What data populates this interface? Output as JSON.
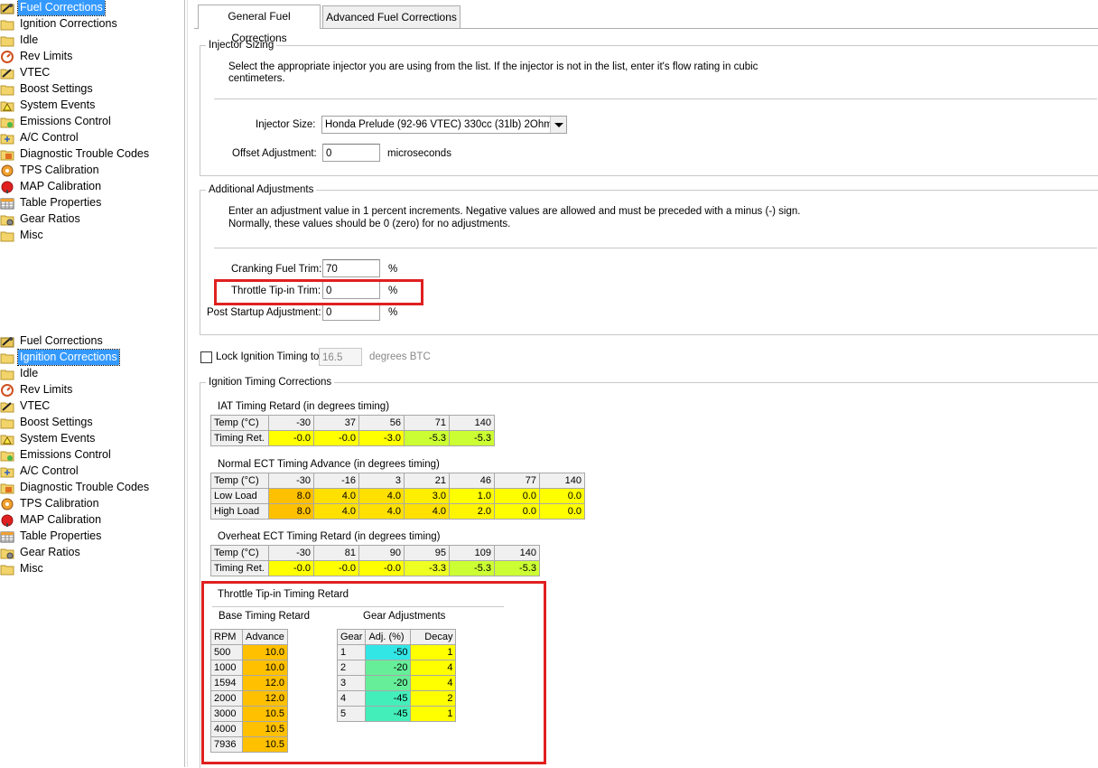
{
  "tree_top": {
    "selected_index": 0,
    "items": [
      {
        "label": "Fuel Corrections",
        "icon": "fuel-icon"
      },
      {
        "label": "Ignition Corrections",
        "icon": "folder-icon"
      },
      {
        "label": "Idle",
        "icon": "folder-icon"
      },
      {
        "label": "Rev Limits",
        "icon": "rev-limit-icon"
      },
      {
        "label": "VTEC",
        "icon": "vtec-icon"
      },
      {
        "label": "Boost Settings",
        "icon": "folder-icon"
      },
      {
        "label": "System Events",
        "icon": "warning-folder-icon"
      },
      {
        "label": "Emissions Control",
        "icon": "emissions-icon"
      },
      {
        "label": "A/C Control",
        "icon": "ac-icon"
      },
      {
        "label": "Diagnostic Trouble Codes",
        "icon": "dtc-icon"
      },
      {
        "label": "TPS Calibration",
        "icon": "tps-icon"
      },
      {
        "label": "MAP Calibration",
        "icon": "map-icon"
      },
      {
        "label": "Table Properties",
        "icon": "table-icon"
      },
      {
        "label": "Gear Ratios",
        "icon": "gear-icon"
      },
      {
        "label": "Misc",
        "icon": "folder-icon"
      }
    ]
  },
  "tree_bottom": {
    "selected_index": 1,
    "items": [
      {
        "label": "Fuel Corrections",
        "icon": "fuel-icon"
      },
      {
        "label": "Ignition Corrections",
        "icon": "folder-icon"
      },
      {
        "label": "Idle",
        "icon": "folder-icon"
      },
      {
        "label": "Rev Limits",
        "icon": "rev-limit-icon"
      },
      {
        "label": "VTEC",
        "icon": "vtec-icon"
      },
      {
        "label": "Boost Settings",
        "icon": "folder-icon"
      },
      {
        "label": "System Events",
        "icon": "warning-folder-icon"
      },
      {
        "label": "Emissions Control",
        "icon": "emissions-icon"
      },
      {
        "label": "A/C Control",
        "icon": "ac-icon"
      },
      {
        "label": "Diagnostic Trouble Codes",
        "icon": "dtc-icon"
      },
      {
        "label": "TPS Calibration",
        "icon": "tps-icon"
      },
      {
        "label": "MAP Calibration",
        "icon": "map-icon"
      },
      {
        "label": "Table Properties",
        "icon": "table-icon"
      },
      {
        "label": "Gear Ratios",
        "icon": "gear-icon"
      },
      {
        "label": "Misc",
        "icon": "folder-icon"
      }
    ]
  },
  "tabs": {
    "general": "General Fuel Corrections",
    "advanced": "Advanced Fuel Corrections"
  },
  "injector": {
    "title": "Injector Sizing",
    "desc_line1": "Select the appropriate injector you are using from the list.  If the injector is not in the list, enter it's flow rating in cubic",
    "desc_line2": "centimeters.",
    "size_label": "Injector Size:",
    "size_value": "Honda Prelude (92-96 VTEC) 330cc (31lb) 2Ohm",
    "offset_label": "Offset Adjustment:",
    "offset_value": "0",
    "offset_unit": "microseconds"
  },
  "additional": {
    "title": "Additional Adjustments",
    "desc_line1": "Enter an adjustment value in 1 percent increments. Negative values are allowed and must be preceded with a minus (-) sign.",
    "desc_line2": " Normally, these values should be 0 (zero) for no adjustments.",
    "cranking_label": "Cranking Fuel Trim:",
    "cranking_value": "70",
    "tipin_label": "Throttle Tip-in Trim:",
    "tipin_value": "0",
    "post_label": "Post Startup Adjustment:",
    "post_value": "0",
    "unit": "%"
  },
  "lock_timing": {
    "label": "Lock Ignition Timing to:",
    "value": "16.5",
    "unit": "degrees BTC"
  },
  "ignition": {
    "title": "Ignition Timing Corrections",
    "iat": {
      "title": "IAT Timing Retard (in degrees timing)",
      "row_temp": "Temp (°C)",
      "row_val": "Timing Ret.",
      "temps": [
        "-30",
        "37",
        "56",
        "71",
        "140"
      ],
      "values": [
        "-0.0",
        "-0.0",
        "-3.0",
        "-5.3",
        "-5.3"
      ],
      "colors": [
        "#ffff00",
        "#ffff00",
        "#ffff00",
        "#ccff33",
        "#ccff33"
      ]
    },
    "ect": {
      "title": "Normal ECT Timing Advance (in degrees timing)",
      "row_temp": "Temp (°C)",
      "row_low": "Low Load",
      "row_high": "High Load",
      "temps": [
        "-30",
        "-16",
        "3",
        "21",
        "46",
        "77",
        "140"
      ],
      "low": [
        "8.0",
        "4.0",
        "4.0",
        "3.0",
        "1.0",
        "0.0",
        "0.0"
      ],
      "high": [
        "8.0",
        "4.0",
        "4.0",
        "4.0",
        "2.0",
        "0.0",
        "0.0"
      ],
      "low_colors": [
        "#ffc000",
        "#ffe000",
        "#ffe000",
        "#ffee00",
        "#ffff00",
        "#ffff00",
        "#ffff00"
      ],
      "high_colors": [
        "#ffc000",
        "#ffe000",
        "#ffe000",
        "#ffe000",
        "#fff500",
        "#ffff00",
        "#ffff00"
      ]
    },
    "overheat": {
      "title": "Overheat ECT Timing Retard (in degrees timing)",
      "row_temp": "Temp (°C)",
      "row_val": "Timing Ret.",
      "temps": [
        "-30",
        "81",
        "90",
        "95",
        "109",
        "140"
      ],
      "values": [
        "-0.0",
        "-0.0",
        "-0.0",
        "-3.3",
        "-5.3",
        "-5.3"
      ],
      "colors": [
        "#ffff00",
        "#ffff00",
        "#ffff00",
        "#eeff22",
        "#ccff33",
        "#ccff33"
      ]
    },
    "tipin": {
      "title": "Throttle Tip-in Timing Retard",
      "base_title": "Base Timing Retard",
      "gear_title": "Gear Adjustments",
      "base_headers": [
        "RPM",
        "Advance"
      ],
      "base_rows": [
        [
          "500",
          "10.0"
        ],
        [
          "1000",
          "10.0"
        ],
        [
          "1594",
          "12.0"
        ],
        [
          "2000",
          "12.0"
        ],
        [
          "3000",
          "10.5"
        ],
        [
          "4000",
          "10.5"
        ],
        [
          "7936",
          "10.5"
        ]
      ],
      "gear_headers": [
        "Gear",
        "Adj. (%)",
        "Decay"
      ],
      "gear_rows": [
        [
          "1",
          "-50",
          "1"
        ],
        [
          "2",
          "-20",
          "4"
        ],
        [
          "3",
          "-20",
          "4"
        ],
        [
          "4",
          "-45",
          "2"
        ],
        [
          "5",
          "-45",
          "1"
        ]
      ],
      "gear_adj_colors": [
        "#33e6e6",
        "#66ee99",
        "#66ee99",
        "#44eebb",
        "#44eebb"
      ],
      "base_color": "#ffc000",
      "decay_color": "#ffff00"
    }
  }
}
